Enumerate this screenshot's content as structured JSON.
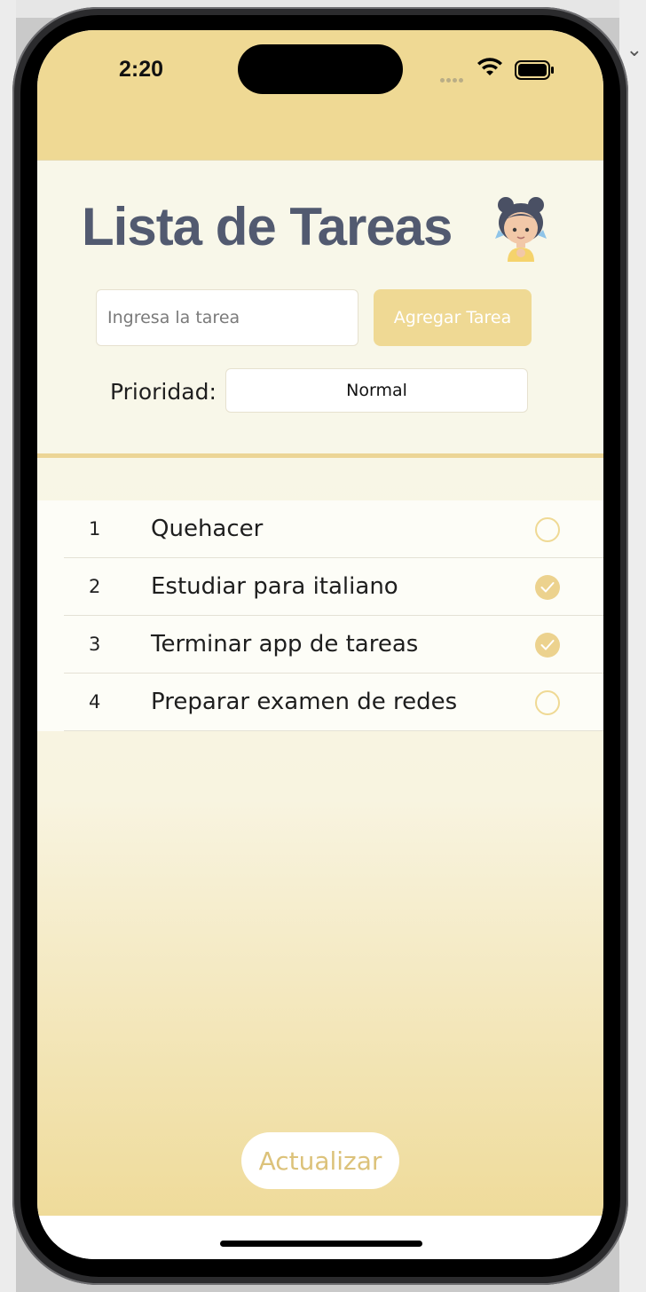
{
  "status_bar": {
    "time": "2:20"
  },
  "header": {
    "title": "Lista de Tareas"
  },
  "form": {
    "task_placeholder": "Ingresa la tarea",
    "add_button": "Agregar Tarea",
    "priority_label": "Prioridad:",
    "priority_value": "Normal"
  },
  "tasks": [
    {
      "number": "1",
      "text": "Quehacer",
      "done": false
    },
    {
      "number": "2",
      "text": "Estudiar para italiano",
      "done": true
    },
    {
      "number": "3",
      "text": "Terminar app de tareas",
      "done": true
    },
    {
      "number": "4",
      "text": "Preparar examen de redes",
      "done": false
    }
  ],
  "footer": {
    "refresh_button": "Actualizar"
  },
  "colors": {
    "accent": "#efd994",
    "title": "#525a70",
    "background": "#f8f7e9"
  }
}
